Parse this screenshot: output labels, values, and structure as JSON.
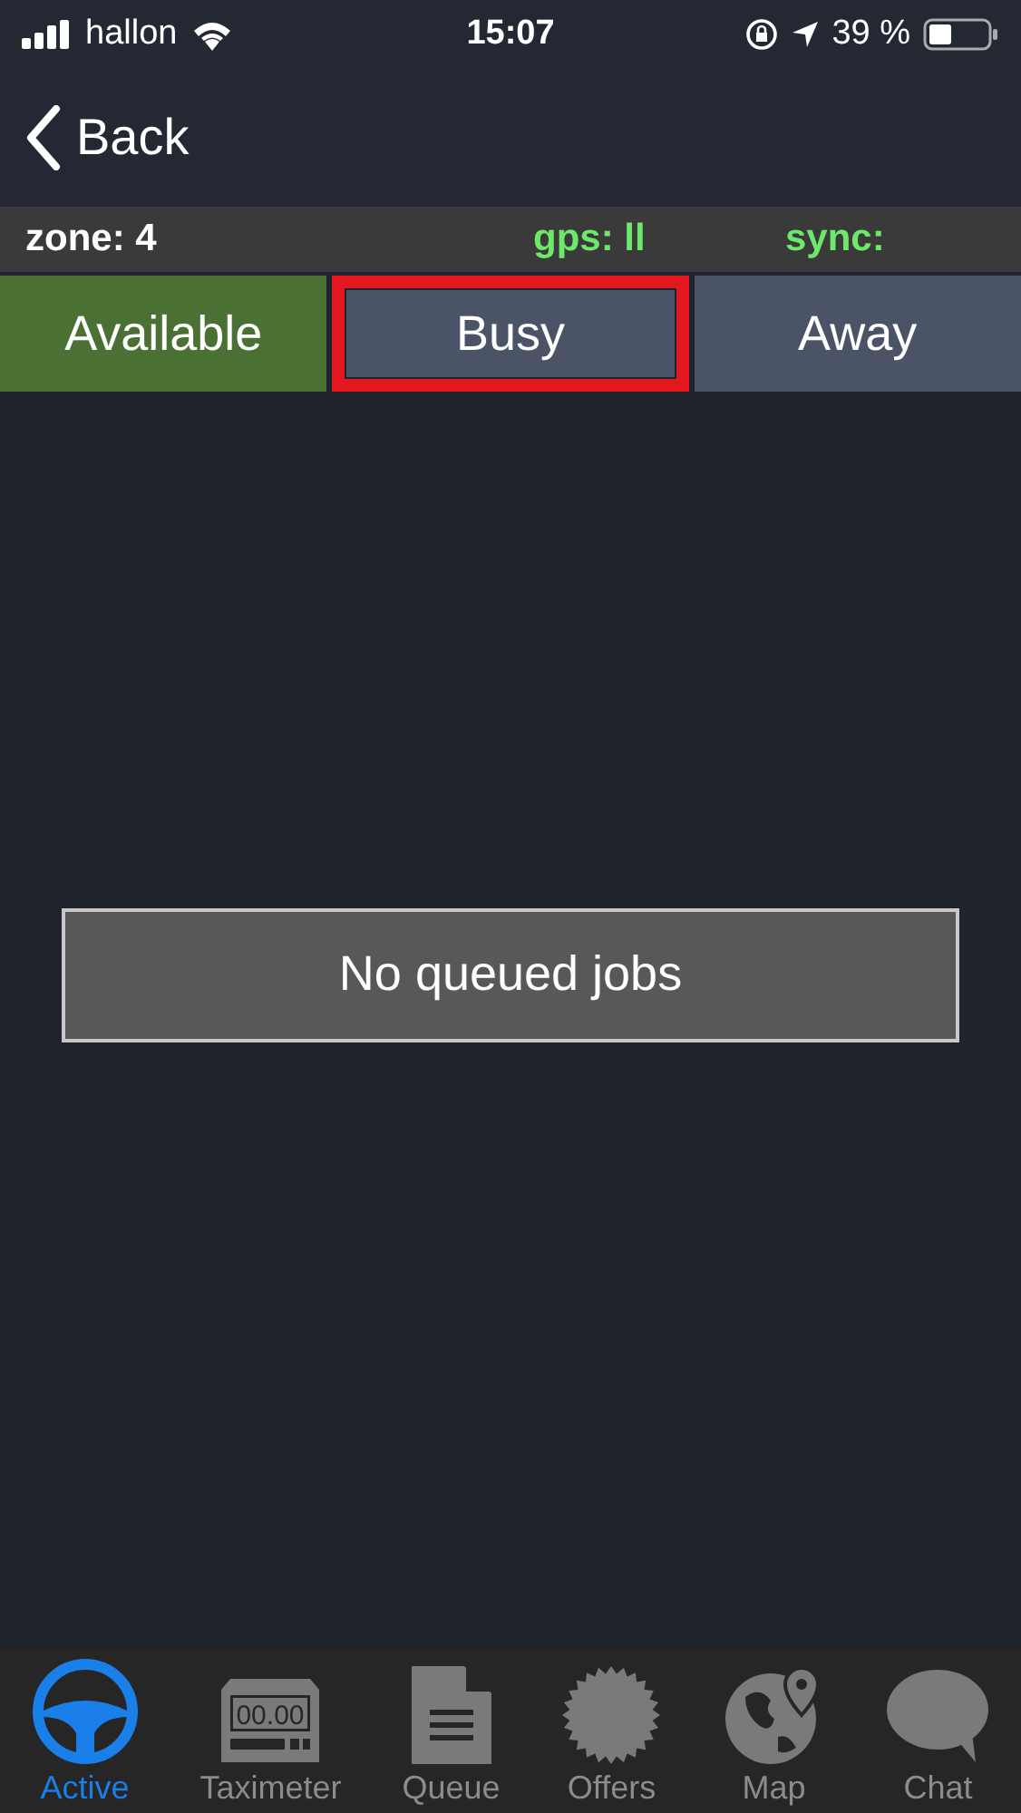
{
  "status_bar": {
    "carrier": "hallon",
    "time": "15:07",
    "battery_text": "39 %"
  },
  "nav": {
    "back_label": "Back"
  },
  "info_bar": {
    "zone": "zone: 4",
    "gps": "gps: ll",
    "sync": "sync:"
  },
  "status_segments": [
    {
      "label": "Available",
      "selected": true,
      "highlighted": false
    },
    {
      "label": "Busy",
      "selected": false,
      "highlighted": true
    },
    {
      "label": "Away",
      "selected": false,
      "highlighted": false
    }
  ],
  "message": "No queued jobs",
  "tab_bar": [
    {
      "kind": "wheel",
      "label": "Active",
      "selected": true
    },
    {
      "kind": "meter",
      "label": "Taximeter",
      "selected": false,
      "display": "00.00"
    },
    {
      "kind": "doc",
      "label": "Queue",
      "selected": false
    },
    {
      "kind": "badge",
      "label": "Offers",
      "selected": false
    },
    {
      "kind": "globe",
      "label": "Map",
      "selected": false
    },
    {
      "kind": "bubble",
      "label": "Chat",
      "selected": false
    }
  ]
}
